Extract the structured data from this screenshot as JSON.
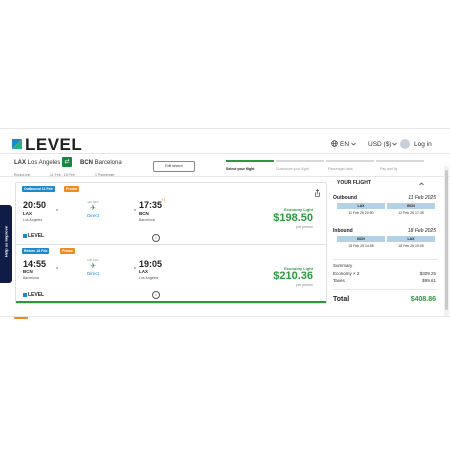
{
  "header": {
    "logo_text": "LEVEL",
    "language": "EN",
    "currency": "USD ($)",
    "login": "Log in",
    "icons": {
      "globe": "globe-icon",
      "chevron": "chevron-down-icon",
      "user": "user-icon"
    }
  },
  "search": {
    "origin_code": "LAX",
    "origin_city": "Los Angeles",
    "destination_code": "BCN",
    "destination_city": "Barcelona",
    "trip_type": "Round-trip",
    "dates": "11 Feb - 18 Feb",
    "passengers": "1 Passenger",
    "edit_label": "Edit search"
  },
  "steps": [
    {
      "label": "Select your flight",
      "active": true
    },
    {
      "label": "Customize your flight",
      "active": false
    },
    {
      "label": "Passenger data",
      "active": false
    },
    {
      "label": "Pay and fly",
      "active": false
    }
  ],
  "side_tab": {
    "label": "Help us improve"
  },
  "flights": [
    {
      "badge": "Outbound 11 Feb",
      "promo": "Promo",
      "dep_time": "20:50",
      "dep_code": "LAX",
      "dep_city": "Los Angeles",
      "duration": "11h 45m",
      "stops": "Direct",
      "arr_time": "17:35",
      "arr_code": "BCN",
      "arr_city": "Barcelona",
      "day_offset": "+1",
      "fare": "Economy Light",
      "price": "$198.50",
      "per_person": "per person",
      "airline": "LEVEL"
    },
    {
      "badge": "Return 18 Feb",
      "promo": "Promo",
      "dep_time": "14:55",
      "dep_code": "BCN",
      "dep_city": "Barcelona",
      "duration": "13h 10m",
      "stops": "Direct",
      "arr_time": "19:05",
      "arr_code": "LAX",
      "arr_city": "Los Angeles",
      "day_offset": "",
      "fare": "Economy Light",
      "price": "$210.36",
      "per_person": "per person",
      "airline": "LEVEL"
    }
  ],
  "summary": {
    "title": "YOUR FLIGHT",
    "outbound": {
      "label": "Outbound",
      "date": "11 Feb 2025",
      "from": "LAX",
      "to": "BCN",
      "from_time": "11 Feb 25 20:50",
      "to_time": "12 Feb 25 17:35"
    },
    "inbound": {
      "label": "Inbound",
      "date": "18 Feb 2025",
      "from": "BCN",
      "to": "LAX",
      "from_time": "18 Feb 25 14:55",
      "to_time": "18 Feb 25 19:05"
    },
    "summary_label": "Summary",
    "lines": [
      {
        "label": "Economy × 2",
        "value": "$309.25"
      },
      {
        "label": "Taxes",
        "value": "$99.61"
      }
    ],
    "total_label": "Total",
    "total_value": "$408.86"
  },
  "colors": {
    "brand_green": "#2b9a3f",
    "brand_blue": "#1e88c9",
    "promo_orange": "#ef8a1c",
    "side_tab_navy": "#0f1d46"
  }
}
